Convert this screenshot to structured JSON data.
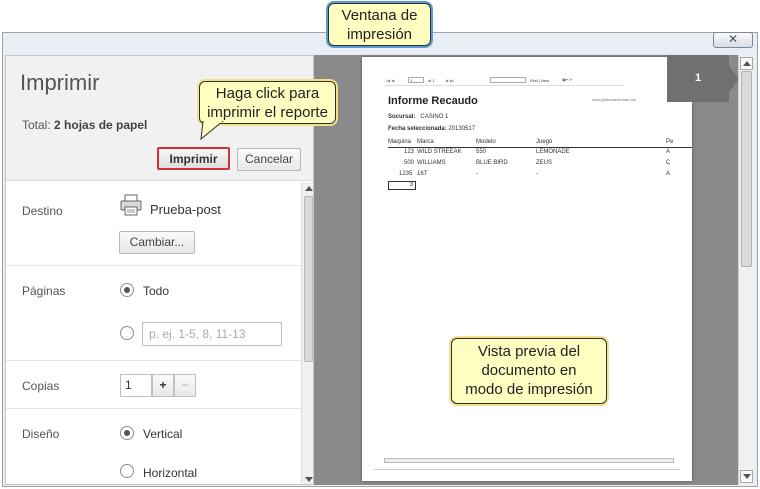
{
  "callouts": {
    "window_line1": "Ventana de",
    "window_line2": "impresión",
    "print_line1": "Haga click para",
    "print_line2": "imprimir el reporte",
    "preview_line1": "Vista previa del",
    "preview_line2": "documento en",
    "preview_line3": "modo de impresión"
  },
  "dialog": {
    "close_glyph": "✕",
    "title": "Imprimir",
    "total_label": "Total:",
    "total_value": "2 hojas de papel",
    "print_button": "Imprimir",
    "cancel_button": "Cancelar"
  },
  "settings": {
    "destination_label": "Destino",
    "printer_name": "Prueba-post",
    "change_button": "Cambiar...",
    "pages_label": "Páginas",
    "pages_all": "Todo",
    "pages_range_placeholder": "p. ej. 1-5, 8, 11-13",
    "copies_label": "Copias",
    "copies_value": "1",
    "copies_plus": "+",
    "copies_minus": "−",
    "layout_label": "Diseño",
    "layout_vertical": "Vertical",
    "layout_horizontal": "Horizontal"
  },
  "preview": {
    "page_badge": "1",
    "report_title": "Informe Recaudo",
    "site": "www.globussistemas.net",
    "branch_label": "Sucursal:",
    "branch_value": "CASINO 1",
    "date_label": "Fecha seleccionada:",
    "date_value": "20130517",
    "toolbar_page": "1",
    "toolbar_of": "of 1",
    "toolbar_find": "Find | Next",
    "columns": [
      "Maquina",
      "Marca",
      "Modelo",
      "Juego",
      "Pe"
    ],
    "rows": [
      [
        "123",
        "WILD STREEAK",
        "550",
        "LEMONADE",
        "A"
      ],
      [
        "500",
        "WILLIAMS",
        "BLUE BIRD",
        "ZEUS",
        "C"
      ],
      [
        "1235",
        "16T",
        "-",
        "-",
        "A"
      ]
    ],
    "total_cell": "3"
  }
}
